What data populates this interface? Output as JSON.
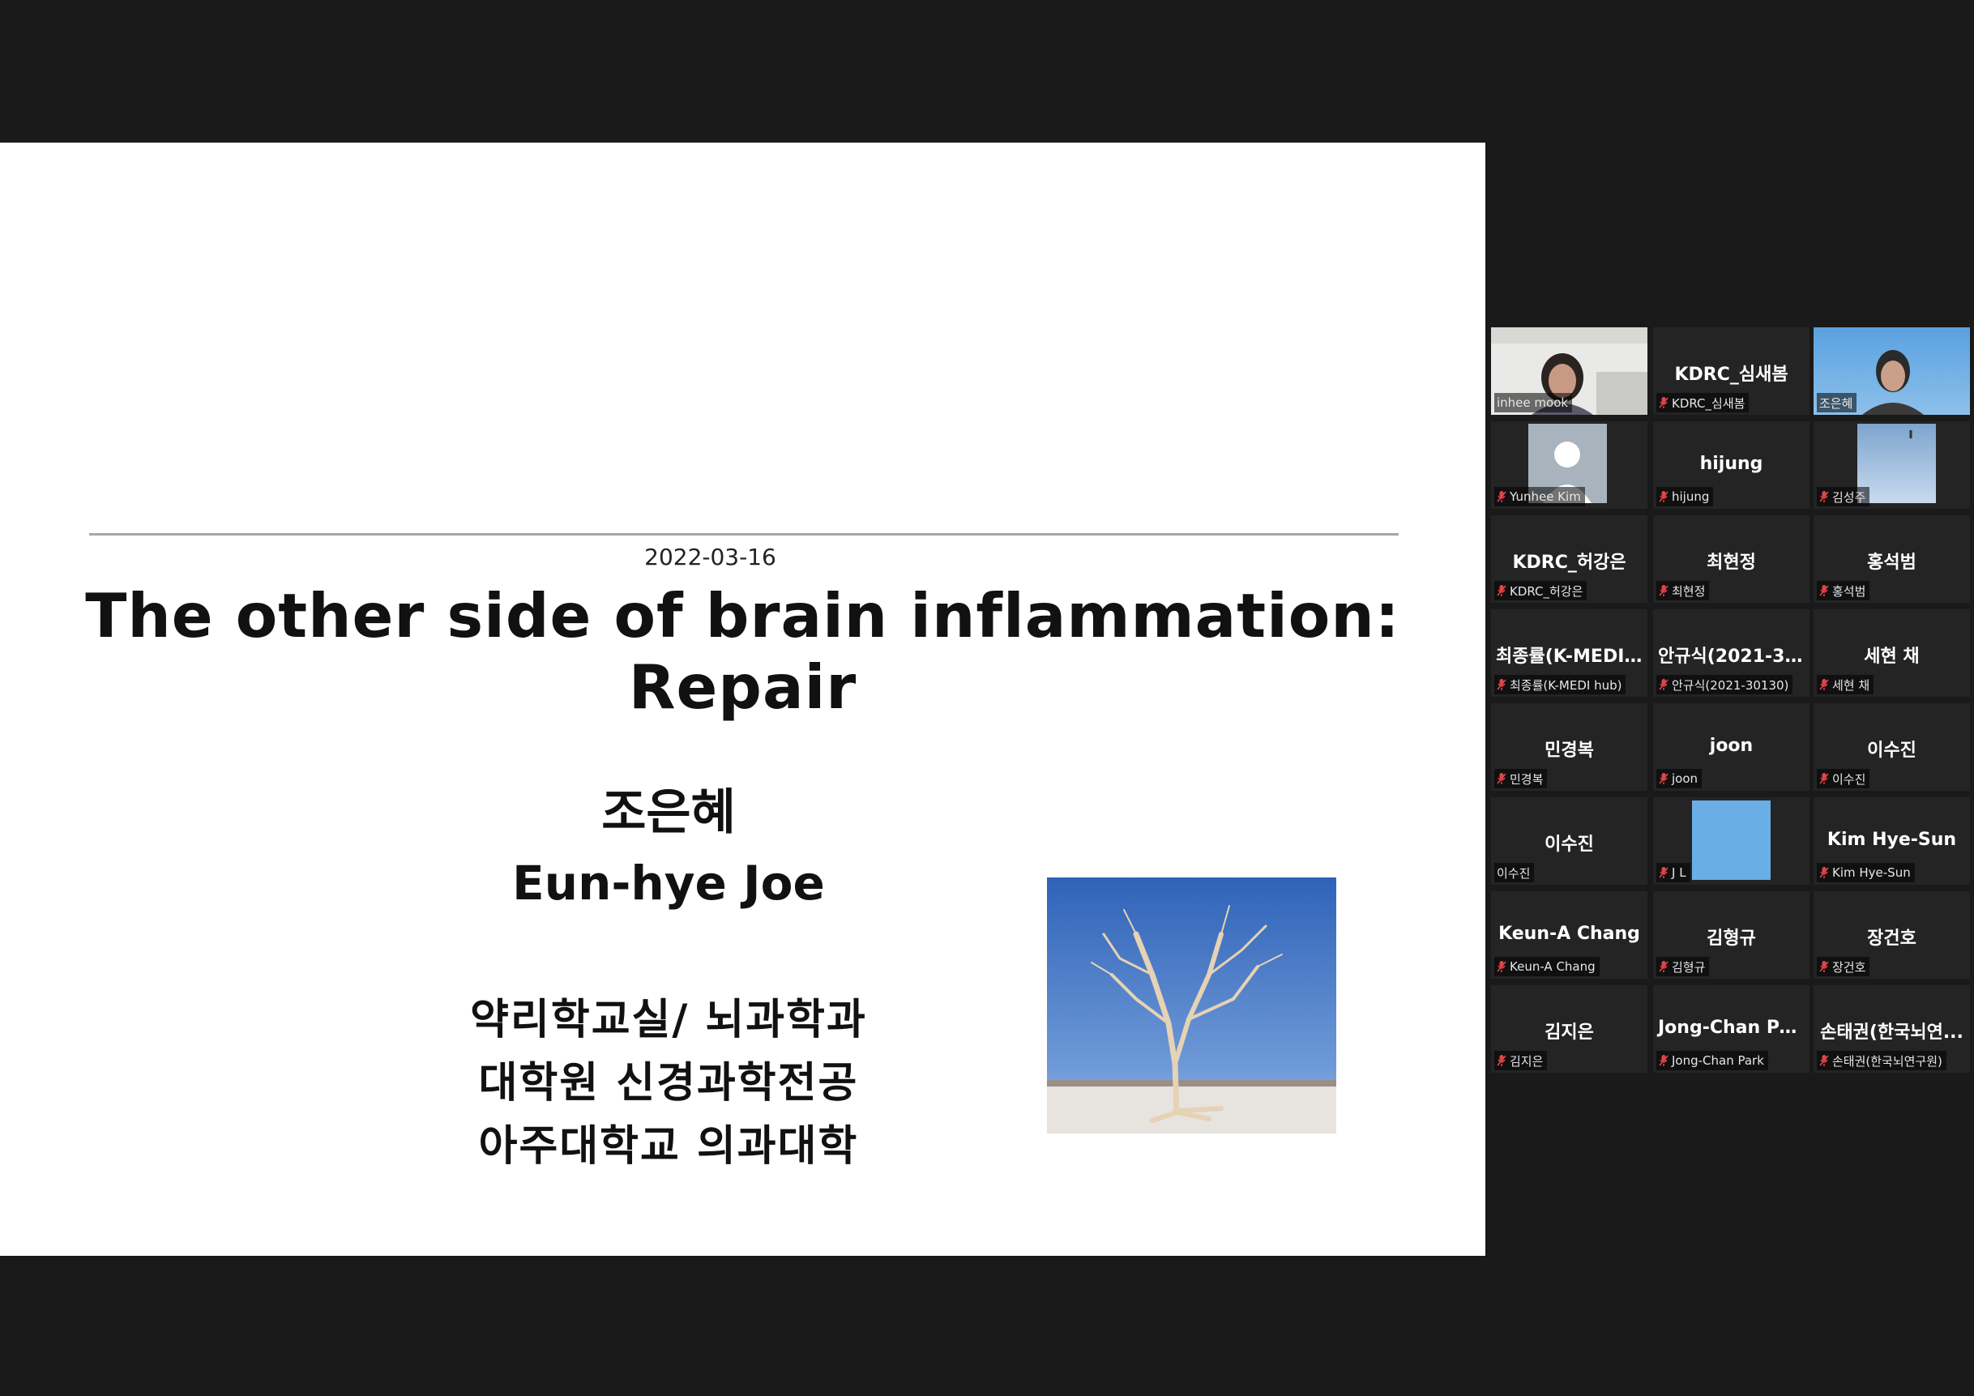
{
  "slide": {
    "title": "The other side of brain inflammation: Repair",
    "date": "2022-03-16",
    "presenter_kr": "조은혜",
    "presenter_en": "Eun-hye Joe",
    "affiliation": [
      "약리학교실/ 뇌과학과",
      "대학원 신경과학전공",
      "아주대학교 의과대학"
    ]
  },
  "participants": [
    {
      "display": "",
      "label": "inhee mook",
      "muted": false,
      "video": "person"
    },
    {
      "display": "KDRC_심새봄",
      "label": "KDRC_심새봄",
      "muted": true,
      "video": "none"
    },
    {
      "display": "",
      "label": "조은혜",
      "muted": false,
      "video": "speaker"
    },
    {
      "display": "",
      "label": "Yunhee Kim",
      "muted": true,
      "video": "avatar"
    },
    {
      "display": "hijung",
      "label": "hijung",
      "muted": true,
      "video": "none"
    },
    {
      "display": "",
      "label": "김성주",
      "muted": true,
      "video": "sky"
    },
    {
      "display": "KDRC_허강은",
      "label": "KDRC_허강은",
      "muted": true,
      "video": "none"
    },
    {
      "display": "최현정",
      "label": "최현정",
      "muted": true,
      "video": "none"
    },
    {
      "display": "홍석범",
      "label": "홍석범",
      "muted": true,
      "video": "none"
    },
    {
      "display": "최종률(K-MEDI...",
      "label": "최종률(K-MEDI hub)",
      "muted": true,
      "video": "none"
    },
    {
      "display": "안규식(2021-30...",
      "label": "안규식(2021-30130)",
      "muted": true,
      "video": "none"
    },
    {
      "display": "세현 채",
      "label": "세현 채",
      "muted": true,
      "video": "none"
    },
    {
      "display": "민경복",
      "label": "민경복",
      "muted": true,
      "video": "none"
    },
    {
      "display": "joon",
      "label": "joon",
      "muted": true,
      "video": "none"
    },
    {
      "display": "이수진",
      "label": "이수진",
      "muted": true,
      "video": "none"
    },
    {
      "display": "이수진",
      "label": "이수진",
      "muted": false,
      "video": "none"
    },
    {
      "display": "",
      "label": "J L",
      "muted": true,
      "video": "blue"
    },
    {
      "display": "Kim Hye-Sun",
      "label": "Kim Hye-Sun",
      "muted": true,
      "video": "none"
    },
    {
      "display": "Keun-A Chang",
      "label": "Keun-A Chang",
      "muted": true,
      "video": "none"
    },
    {
      "display": "김형규",
      "label": "김형규",
      "muted": true,
      "video": "none"
    },
    {
      "display": "장건호",
      "label": "장건호",
      "muted": true,
      "video": "none"
    },
    {
      "display": "김지은",
      "label": "김지은",
      "muted": true,
      "video": "none"
    },
    {
      "display": "Jong-Chan Park",
      "label": "Jong-Chan Park",
      "muted": true,
      "video": "none"
    },
    {
      "display": "손태권(한국뇌연...",
      "label": "손태권(한국뇌연구원)",
      "muted": true,
      "video": "none"
    }
  ],
  "colors": {
    "background": "#1a1a1a",
    "tile": "#242424",
    "active_speaker_border": "#c8e05a",
    "muted_icon": "#e0454a"
  }
}
